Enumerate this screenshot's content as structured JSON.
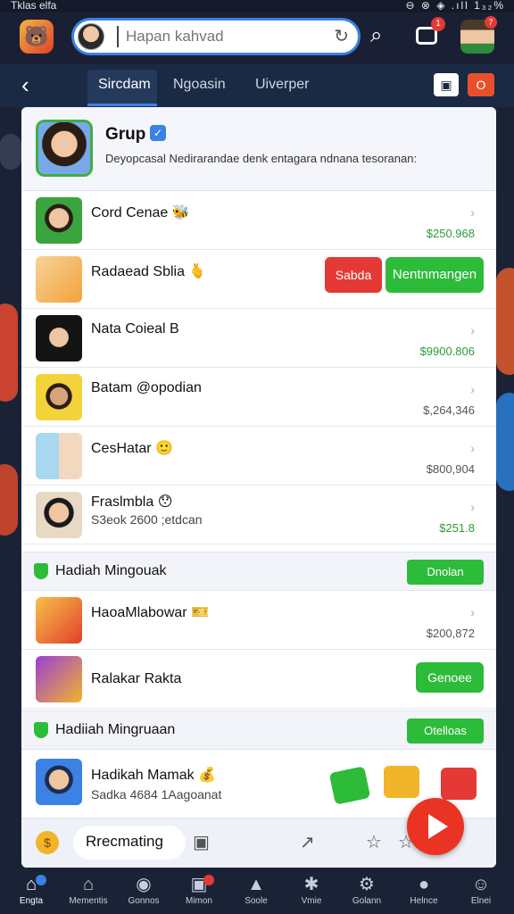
{
  "status_bar": {
    "left": "Tklas elfa",
    "right": "⊖ ⊗ ◈ .ıll 1₃₂%"
  },
  "header": {
    "search_placeholder": "Hapan kahvad",
    "inbox_badge": "1",
    "profile_badge": "7"
  },
  "tabs": [
    {
      "label": "Sircdam"
    },
    {
      "label": "Ngoasin"
    },
    {
      "label": "Uiverper"
    }
  ],
  "tab_right_badge": "O",
  "group": {
    "title": "Grup",
    "description": "Deyopcasal Nedirarandae  denk entagara ndnana tesoranan:"
  },
  "members": [
    {
      "name": "Cord Cenae",
      "emoji": "🐝",
      "amount": "$250.968",
      "amount_color": "#2e9a3a"
    },
    {
      "name": "Radaead Sblia",
      "emoji": "🫰",
      "button_red": "Sabda",
      "button_green": "Nentnmangen"
    },
    {
      "name": "Nata Coiеal B",
      "amount": "$9900.806",
      "amount_color": "#2e9a3a"
    },
    {
      "name": "Batam @opodian",
      "amount": "$,264,346",
      "amount_color": "#555555"
    },
    {
      "name": "CesHatar",
      "emoji": "🙂",
      "amount": "$800,904",
      "amount_color": "#555555"
    },
    {
      "name": "Fraslmbla",
      "emoji": "😯",
      "sub": "S3eok 2600 ;etdcan",
      "amount": "$251.8",
      "amount_color": "#2e9a3a"
    }
  ],
  "section1": {
    "title": "Hadiah Mingouak",
    "button": "Dnolan"
  },
  "gifts": [
    {
      "name": "HaoaMlabowar",
      "emoji": "🎫",
      "amount": "$200,872",
      "amount_color": "#555555"
    },
    {
      "name": "Ralakar Rakta",
      "button": "Genoee"
    }
  ],
  "section2": {
    "title": "Hadiiah Mingruaan",
    "button": "Otelloas"
  },
  "featured": {
    "name": "Hadikah Mamak",
    "tag": "💰",
    "sub": "Sadka 4684 1Aagoanat"
  },
  "compose": {
    "field": "Rrecmating"
  },
  "nav": [
    {
      "label": "Engta",
      "icon": "⌂"
    },
    {
      "label": "Mementis",
      "icon": "⌂"
    },
    {
      "label": "Gonnos",
      "icon": "◉"
    },
    {
      "label": "Mimon",
      "icon": "▣"
    },
    {
      "label": "Soole",
      "icon": "▲"
    },
    {
      "label": "Vmie",
      "icon": "✱"
    },
    {
      "label": "Golann",
      "icon": "⚙"
    },
    {
      "label": "Helnce",
      "icon": "●"
    },
    {
      "label": "Elnei",
      "icon": "☺"
    }
  ]
}
